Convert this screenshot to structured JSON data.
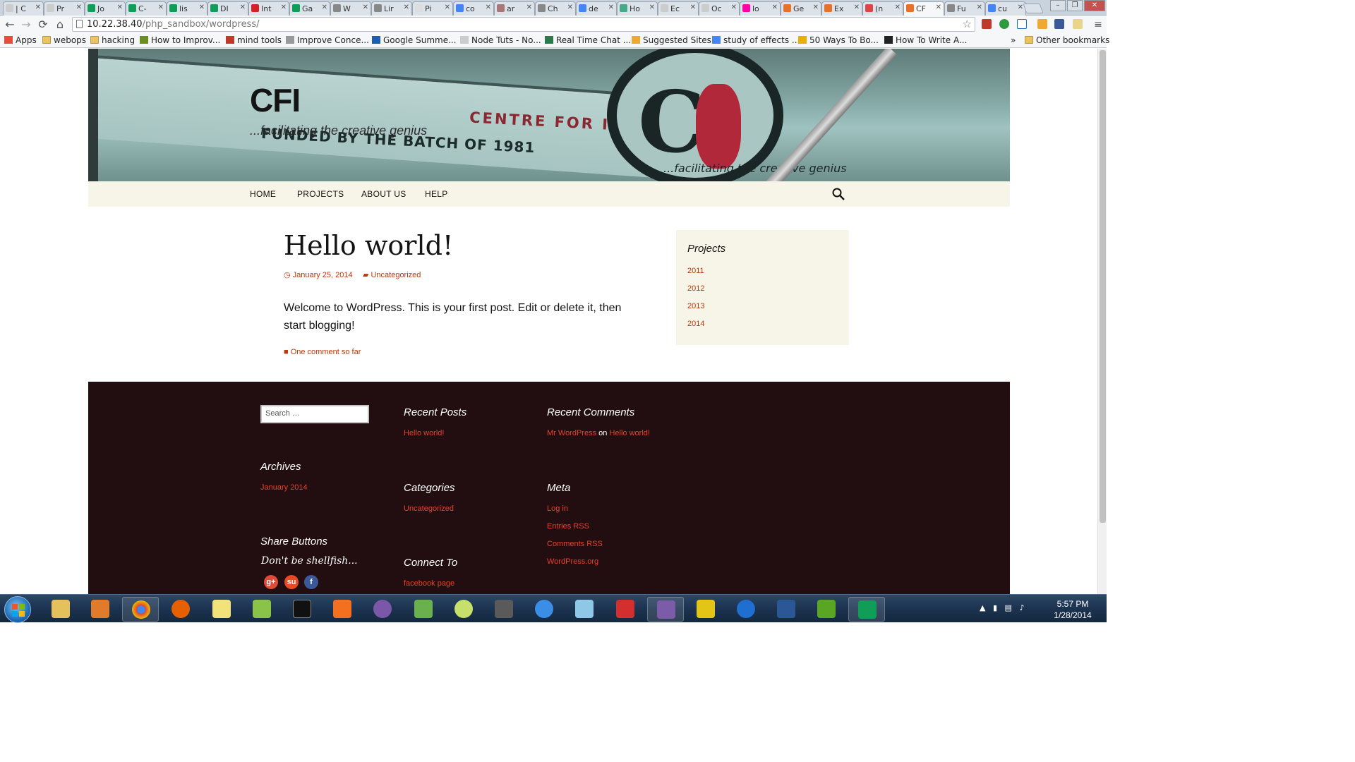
{
  "browser": {
    "tabs": [
      {
        "label": "| C"
      },
      {
        "label": "Pr"
      },
      {
        "label": "Jo"
      },
      {
        "label": "C-"
      },
      {
        "label": "lis"
      },
      {
        "label": "DI"
      },
      {
        "label": "Int"
      },
      {
        "label": "Ga"
      },
      {
        "label": "W"
      },
      {
        "label": "Lir"
      },
      {
        "label": "Pi"
      },
      {
        "label": "co"
      },
      {
        "label": "ar"
      },
      {
        "label": "Ch"
      },
      {
        "label": "de"
      },
      {
        "label": "Ho"
      },
      {
        "label": "Ec"
      },
      {
        "label": "Oc"
      },
      {
        "label": "lo"
      },
      {
        "label": "Ge"
      },
      {
        "label": "Ex"
      },
      {
        "label": "(n"
      },
      {
        "label": "CF"
      },
      {
        "label": "Fu"
      },
      {
        "label": "cu"
      }
    ],
    "url_host": "10.22.38.40",
    "url_path": "/php_sandbox/wordpress/",
    "bookmarks": [
      "Apps",
      "webops",
      "hacking",
      "How to Improv...",
      "mind tools",
      "Improve Conce...",
      "Google Summe...",
      "Node Tuts - No...",
      "Real Time Chat ...",
      "Suggested Sites",
      "study of effects ...",
      "50 Ways To Bo...",
      "How To Write A..."
    ],
    "bookmarks_overflow": "»",
    "other_bookmarks": "Other bookmarks"
  },
  "site": {
    "title": "CFI",
    "description": "...facilitating the creative genius",
    "header_sign": "CENTRE FOR INNOVATION",
    "header_sign2": "FUNDED BY THE BATCH OF 1981",
    "header_tag": "...facilitating the creative genius",
    "nav": [
      "HOME",
      "PROJECTS",
      "ABOUT US",
      "HELP"
    ]
  },
  "post": {
    "title": "Hello world!",
    "date": "January 25, 2014",
    "category": "Uncategorized",
    "body": "Welcome to WordPress. This is your first post. Edit or delete it, then start blogging!",
    "comments_link": "One comment so far"
  },
  "sidebar": {
    "title": "Projects",
    "links": [
      "2011",
      "2012",
      "2013",
      "2014"
    ]
  },
  "footer": {
    "search_placeholder": "Search …",
    "recent_posts_title": "Recent Posts",
    "recent_posts": [
      "Hello world!"
    ],
    "recent_comments_title": "Recent Comments",
    "recent_comment_author": "Mr WordPress",
    "recent_comment_on": "on",
    "recent_comment_post": "Hello world!",
    "archives_title": "Archives",
    "archives": [
      "January 2014"
    ],
    "categories_title": "Categories",
    "categories": [
      "Uncategorized"
    ],
    "meta_title": "Meta",
    "meta_links": [
      "Log in",
      "Entries RSS",
      "Comments RSS",
      "WordPress.org"
    ],
    "share_title": "Share Buttons",
    "share_tagline": "Don't be shellfish...",
    "share_buttons": [
      "g+",
      "su",
      "f"
    ],
    "connect_title": "Connect To",
    "connect_links": [
      "facebook page"
    ]
  },
  "taskbar": {
    "time": "5:57 PM",
    "date": "1/28/2014"
  },
  "colors": {
    "link": "#bc360a",
    "footer_bg": "#220e10",
    "nav_bg": "#f7f5e7"
  }
}
